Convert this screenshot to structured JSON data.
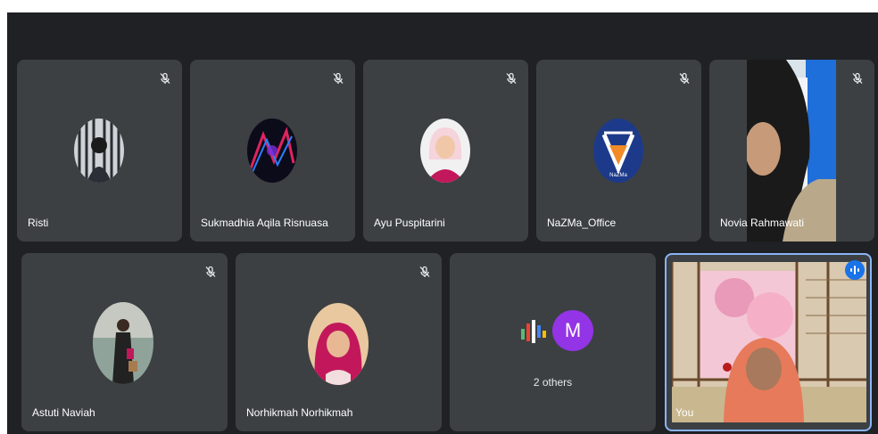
{
  "colors": {
    "stage": "#202124",
    "tile": "#3c4043",
    "accent": "#1a73e8",
    "others_avatar": "#9334e6"
  },
  "participants": [
    {
      "name": "Risti",
      "muted": true
    },
    {
      "name": "Sukmadhia Aqila Risnuasa",
      "muted": true
    },
    {
      "name": "Ayu Puspitarini",
      "muted": true
    },
    {
      "name": "NaZMa_Office",
      "muted": true
    },
    {
      "name": "Novia Rahmawati",
      "muted": true
    },
    {
      "name": "Astuti Naviah",
      "muted": true
    },
    {
      "name": "Norhikmah Norhikmah",
      "muted": true
    }
  ],
  "logo_text": "NaZMa",
  "others": {
    "label": "2 others",
    "initial": "M"
  },
  "self": {
    "name": "You",
    "speaking": true
  }
}
